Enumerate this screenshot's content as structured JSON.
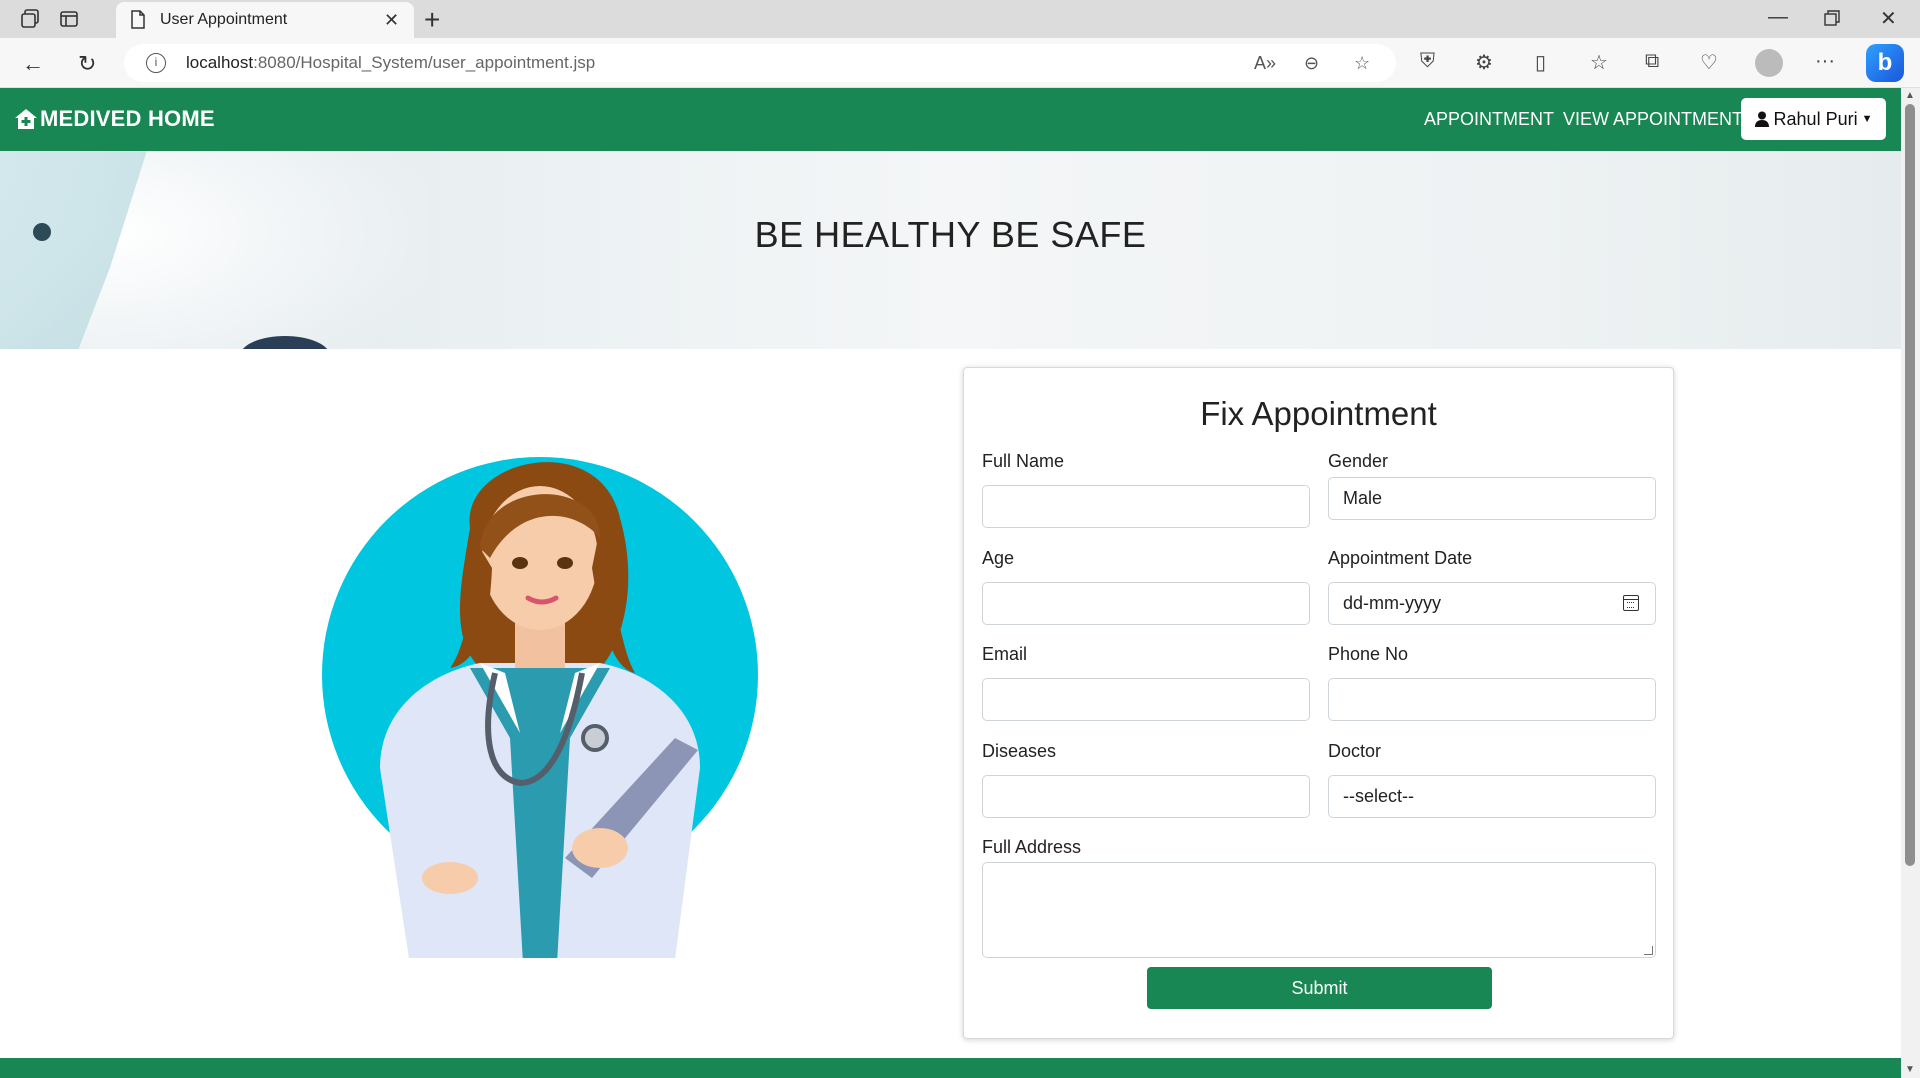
{
  "browser": {
    "tab_title": "User Appointment",
    "url_host": "localhost",
    "url_rest": ":8080/Hospital_System/user_appointment.jsp"
  },
  "navbar": {
    "brand": "MEDIVED HOME",
    "links": [
      "APPOINTMENT",
      "VIEW APPOINTMENT"
    ],
    "user": "Rahul Puri"
  },
  "hero": {
    "headline": "BE HEALTHY BE SAFE"
  },
  "form": {
    "title": "Fix Appointment",
    "full_name": {
      "label": "Full Name",
      "value": ""
    },
    "gender": {
      "label": "Gender",
      "value": "Male"
    },
    "age": {
      "label": "Age",
      "value": ""
    },
    "appointment_date": {
      "label": "Appointment Date",
      "placeholder": "dd-mm-yyyy"
    },
    "email": {
      "label": "Email",
      "value": ""
    },
    "phone": {
      "label": "Phone No",
      "value": ""
    },
    "diseases": {
      "label": "Diseases",
      "value": ""
    },
    "doctor": {
      "label": "Doctor",
      "value": "--select--"
    },
    "address": {
      "label": "Full Address",
      "value": ""
    },
    "submit": "Submit"
  },
  "colors": {
    "brand_green": "#198754",
    "illustration_circle": "#00c6e0"
  }
}
